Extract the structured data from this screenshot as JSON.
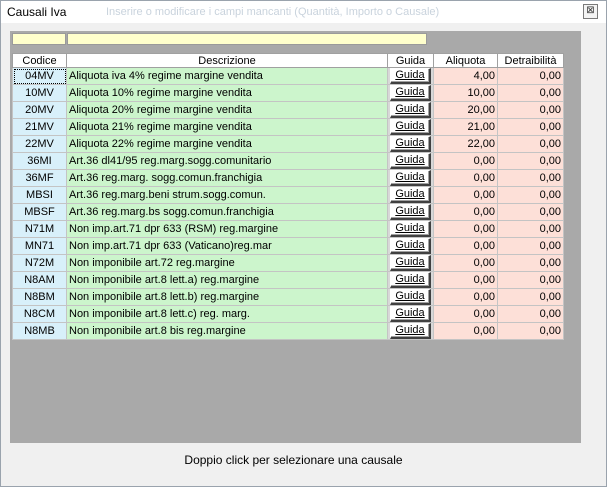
{
  "window": {
    "title": "Causali Iva",
    "faded_text": "Inserire o modificare i campi mancanti (Quantità, Importo o Causale)",
    "close_glyph": "⊠"
  },
  "filters": {
    "code_value": "",
    "desc_value": ""
  },
  "columns": {
    "codice": "Codice",
    "descrizione": "Descrizione",
    "guida": "Guida",
    "aliquota": "Aliquota",
    "detraibilita": "Detraibilità"
  },
  "rows": [
    {
      "code": "04MV",
      "desc": "Aliquota iva 4% regime margine vendita",
      "guida": "Guida",
      "aliquota": "4,00",
      "detraibilita": "0,00"
    },
    {
      "code": "10MV",
      "desc": "Aliquota 10% regime margine vendita",
      "guida": "Guida",
      "aliquota": "10,00",
      "detraibilita": "0,00"
    },
    {
      "code": "20MV",
      "desc": "Aliquota 20% regime margine vendita",
      "guida": "Guida",
      "aliquota": "20,00",
      "detraibilita": "0,00"
    },
    {
      "code": "21MV",
      "desc": "Aliquota 21% regime margine vendita",
      "guida": "Guida",
      "aliquota": "21,00",
      "detraibilita": "0,00"
    },
    {
      "code": "22MV",
      "desc": "Aliquota 22% regime margine vendita",
      "guida": "Guida",
      "aliquota": "22,00",
      "detraibilita": "0,00"
    },
    {
      "code": "36MI",
      "desc": "Art.36 dl41/95 reg.marg.sogg.comunitario",
      "guida": "Guida",
      "aliquota": "0,00",
      "detraibilita": "0,00"
    },
    {
      "code": "36MF",
      "desc": "Art.36 reg.marg. sogg.comun.franchigia",
      "guida": "Guida",
      "aliquota": "0,00",
      "detraibilita": "0,00"
    },
    {
      "code": "MBSI",
      "desc": "Art.36  reg.marg.beni strum.sogg.comun.",
      "guida": "Guida",
      "aliquota": "0,00",
      "detraibilita": "0,00"
    },
    {
      "code": "MBSF",
      "desc": "Art.36 reg.marg.bs sogg.comun.franchigia",
      "guida": "Guida",
      "aliquota": "0,00",
      "detraibilita": "0,00"
    },
    {
      "code": "N71M",
      "desc": "Non imp.art.71 dpr 633 (RSM) reg.margine",
      "guida": "Guida",
      "aliquota": "0,00",
      "detraibilita": "0,00"
    },
    {
      "code": "MN71",
      "desc": "Non imp.art.71 dpr 633 (Vaticano)reg.mar",
      "guida": "Guida",
      "aliquota": "0,00",
      "detraibilita": "0,00"
    },
    {
      "code": "N72M",
      "desc": "Non imponibile art.72 reg.margine",
      "guida": "Guida",
      "aliquota": "0,00",
      "detraibilita": "0,00"
    },
    {
      "code": "N8AM",
      "desc": "Non imponibile art.8 lett.a) reg.margine",
      "guida": "Guida",
      "aliquota": "0,00",
      "detraibilita": "0,00"
    },
    {
      "code": "N8BM",
      "desc": "Non imponibile art.8 lett.b) reg.margine",
      "guida": "Guida",
      "aliquota": "0,00",
      "detraibilita": "0,00"
    },
    {
      "code": "N8CM",
      "desc": "Non imponibile art.8 lett.c) reg. marg.",
      "guida": "Guida",
      "aliquota": "0,00",
      "detraibilita": "0,00"
    },
    {
      "code": "N8MB",
      "desc": "Non imponibile art.8 bis reg.margine",
      "guida": "Guida",
      "aliquota": "0,00",
      "detraibilita": "0,00"
    }
  ],
  "status_text": "Doppio click per selezionare una causale",
  "icons": {
    "search": "binoculars-icon",
    "close": "close-icon"
  },
  "colors": {
    "code_bg": "#d8f0fa",
    "desc_bg": "#ccf5cc",
    "aliquota_bg": "#fde0d8",
    "filter_bg": "#ffffcc",
    "grid_bg": "#a9a9a9"
  }
}
